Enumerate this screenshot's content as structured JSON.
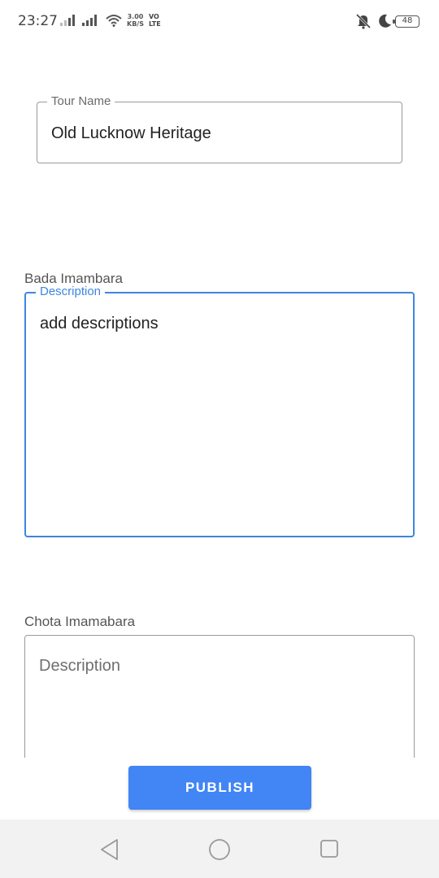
{
  "status_bar": {
    "time": "23:27",
    "net_speed_value": "3.00",
    "net_speed_unit": "KB/S",
    "volte_top": "VO",
    "volte_bottom": "LTE",
    "battery": "48",
    "icons": [
      "signal-icon",
      "wifi-icon",
      "mute-icon",
      "moon-icon",
      "battery-icon"
    ]
  },
  "form": {
    "tour_name": {
      "label": "Tour Name",
      "value": "Old Lucknow Heritage"
    },
    "places": [
      {
        "name": "Bada Imambara",
        "description_label": "Description",
        "description_value": "add descriptions",
        "focused": true
      },
      {
        "name": "Chota Imamabara",
        "description_placeholder": "Description",
        "focused": false
      }
    ]
  },
  "actions": {
    "publish_label": "PUBLISH",
    "accent_color": "#4285f4"
  },
  "nav_bar": {
    "icons": [
      "back-icon",
      "home-icon",
      "recents-icon"
    ]
  }
}
